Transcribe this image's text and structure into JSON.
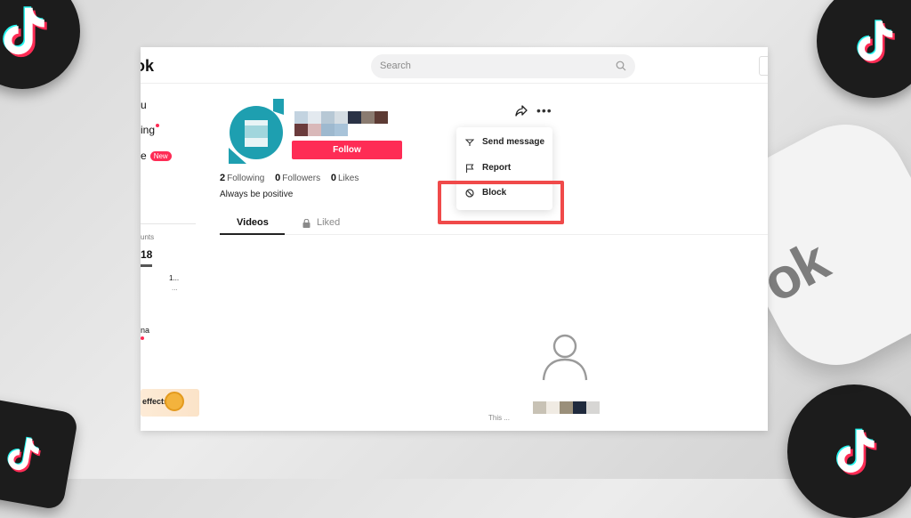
{
  "topbar": {
    "brand_fragment": "ok",
    "search_placeholder": "Search"
  },
  "sidebar": {
    "fragments": [
      "u",
      "ing",
      "e",
      "unts",
      "18",
      "1...",
      "...",
      "na",
      "effects,"
    ],
    "new_badge": "New"
  },
  "profile": {
    "follow_label": "Follow",
    "following_count": "2",
    "following_label": "Following",
    "followers_count": "0",
    "followers_label": "Followers",
    "likes_count": "0",
    "likes_label": "Likes",
    "bio": "Always be positive"
  },
  "tabs": [
    {
      "label": "Videos"
    },
    {
      "label": "Liked"
    }
  ],
  "menu": {
    "items": [
      {
        "label": "Send message",
        "icon": "send-icon"
      },
      {
        "label": "Report",
        "icon": "flag-icon"
      },
      {
        "label": "Block",
        "icon": "block-icon"
      }
    ]
  },
  "empty_state": {
    "text_fragment": "This ..."
  },
  "colors": {
    "accent": "#fe2c55",
    "highlight": "#f04a4a",
    "avatar_teal": "#1e9fb0"
  }
}
